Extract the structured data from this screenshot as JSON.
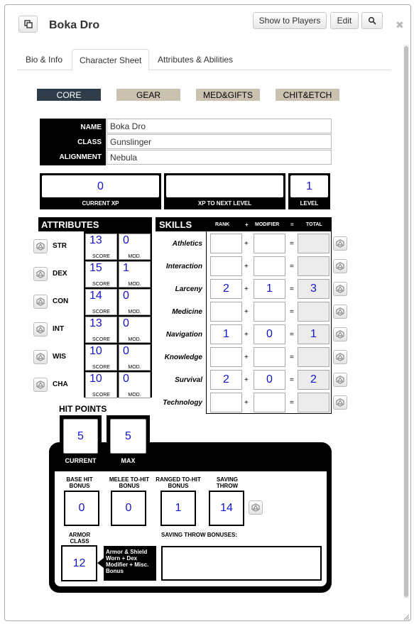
{
  "window": {
    "title": "Boka Dro"
  },
  "header_buttons": {
    "show_to_players": "Show to Players",
    "edit": "Edit"
  },
  "tabs": [
    "Bio & Info",
    "Character Sheet",
    "Attributes & Abilities"
  ],
  "sheet_tabs": [
    "CORE",
    "GEAR",
    "MED&GIFTS",
    "CHIT&ETCH"
  ],
  "identity": {
    "name_label": "NAME",
    "name": "Boka Dro",
    "class_label": "CLASS",
    "class": "Gunslinger",
    "alignment_label": "ALIGNMENT",
    "alignment": "Nebula"
  },
  "xp": {
    "current_xp": "0",
    "current_xp_label": "CURRENT XP",
    "xp_to_next": "",
    "xp_to_next_label": "XP TO NEXT LEVEL",
    "level": "1",
    "level_label": "LEVEL"
  },
  "attributes": {
    "header": "ATTRIBUTES",
    "score_caption": "SCORE",
    "mod_caption": "MOD.",
    "items": [
      {
        "name": "STR",
        "score": "13",
        "mod": "0"
      },
      {
        "name": "DEX",
        "score": "15",
        "mod": "1"
      },
      {
        "name": "CON",
        "score": "14",
        "mod": "0"
      },
      {
        "name": "INT",
        "score": "13",
        "mod": "0"
      },
      {
        "name": "WIS",
        "score": "10",
        "mod": "0"
      },
      {
        "name": "CHA",
        "score": "10",
        "mod": "0"
      }
    ]
  },
  "skills": {
    "header": "SKILLS",
    "col_rank": "RANK",
    "col_plus": "+",
    "col_modifier": "MODIFIER",
    "col_eq": "=",
    "col_total": "TOTAL",
    "plus": "+",
    "eq": "=",
    "items": [
      {
        "name": "Athletics",
        "rank": "",
        "modifier": "",
        "total": ""
      },
      {
        "name": "Interaction",
        "rank": "",
        "modifier": "",
        "total": ""
      },
      {
        "name": "Larceny",
        "rank": "2",
        "modifier": "1",
        "total": "3"
      },
      {
        "name": "Medicine",
        "rank": "",
        "modifier": "",
        "total": ""
      },
      {
        "name": "Navigation",
        "rank": "1",
        "modifier": "0",
        "total": "1"
      },
      {
        "name": "Knowledge",
        "rank": "",
        "modifier": "",
        "total": ""
      },
      {
        "name": "Survival",
        "rank": "2",
        "modifier": "0",
        "total": "2"
      },
      {
        "name": "Technology",
        "rank": "",
        "modifier": "",
        "total": ""
      }
    ]
  },
  "hit_points": {
    "header": "HIT POINTS",
    "current": "5",
    "current_label": "CURRENT",
    "max": "5",
    "max_label": "MAX"
  },
  "combat": {
    "base_hit_label": "BASE HIT BONUS",
    "base_hit": "0",
    "melee_label": "MELEE TO-HIT BONUS",
    "melee": "0",
    "ranged_label": "RANGED TO-HIT BONUS",
    "ranged": "1",
    "saving_label": "SAVING THROW",
    "saving": "14",
    "armor_label": "ARMOR CLASS",
    "armor": "12",
    "armor_note": "Armor & Shield Worn + Dex Modifier + Misc. Bonus",
    "saving_bonuses_label": "SAVING THROW BONUSES:",
    "saving_bonuses": ""
  },
  "colors": {
    "accent_blue": "#1515c8",
    "core_tab": "#2f3d4a",
    "other_tab": "#c9c2b0"
  }
}
